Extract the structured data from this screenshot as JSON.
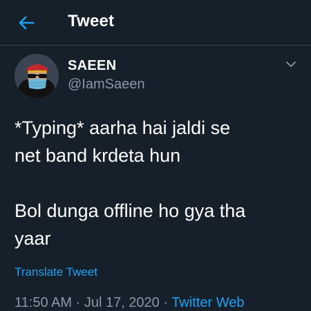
{
  "header": {
    "title": "Tweet",
    "back_icon": "arrow-left-icon"
  },
  "colors": {
    "background": "#15202b",
    "accent": "#1da1f2",
    "secondary_text": "#8899a6",
    "divider": "#38444d"
  },
  "author": {
    "display_name": "SAEEN",
    "handle": "@IamSaeen",
    "avatar": "avatar-icon"
  },
  "tweet": {
    "lines": [
      "*Typing* aarha hai jaldi se",
      "net band krdeta hun",
      "",
      "Bol dunga offline ho gya tha",
      "yaar"
    ],
    "translate_label": "Translate Tweet",
    "time": "11:50 AM",
    "separator": "·",
    "date": "Jul 17, 2020",
    "source": "Twitter Web"
  }
}
